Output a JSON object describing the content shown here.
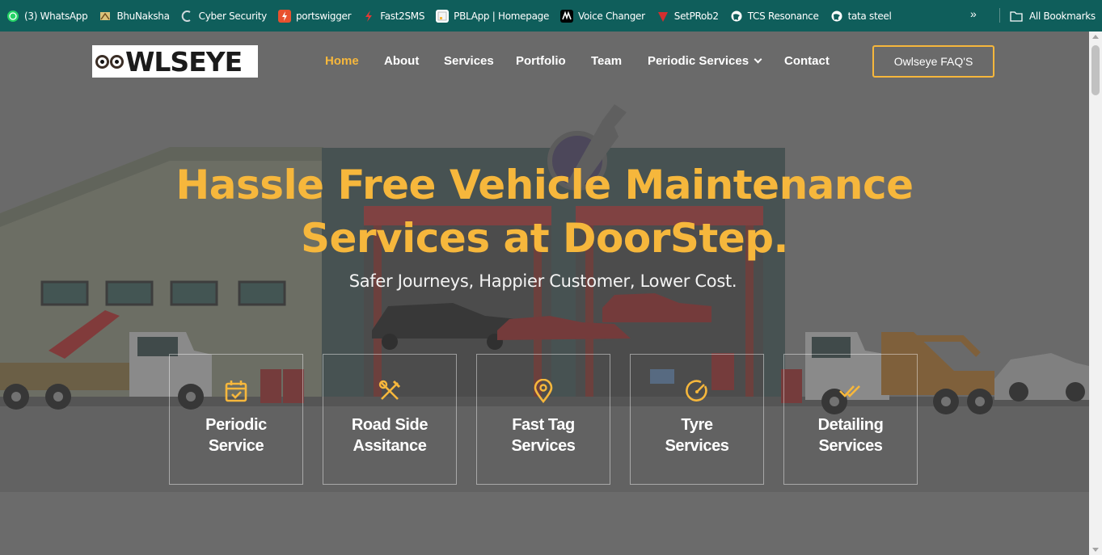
{
  "bookmarks_bar": {
    "items": [
      {
        "label": "(3) WhatsApp",
        "icon": "whatsapp-icon"
      },
      {
        "label": "BhuNaksha",
        "icon": "bhunaksha-icon"
      },
      {
        "label": "Cyber Security",
        "icon": "cyber-security-icon"
      },
      {
        "label": "portswigger",
        "icon": "portswigger-icon"
      },
      {
        "label": "Fast2SMS",
        "icon": "fast2sms-icon"
      },
      {
        "label": "PBLApp | Homepage",
        "icon": "pblapp-icon"
      },
      {
        "label": "Voice Changer",
        "icon": "voice-changer-icon"
      },
      {
        "label": "SetPRob2",
        "icon": "setprob-icon"
      },
      {
        "label": "TCS Resonance",
        "icon": "globe-icon"
      },
      {
        "label": "tata steel",
        "icon": "globe-icon"
      }
    ],
    "more": "»",
    "all_bookmarks": "All Bookmarks"
  },
  "header": {
    "logo_text": "WLSEYE",
    "nav": [
      {
        "label": "Home",
        "active": true
      },
      {
        "label": "About"
      },
      {
        "label": "Services"
      },
      {
        "label": "Portfolio"
      },
      {
        "label": "Team"
      },
      {
        "label": "Periodic Services",
        "has_dropdown": true
      },
      {
        "label": "Contact"
      }
    ],
    "faq_button": "Owlseye FAQ'S"
  },
  "hero": {
    "title_line1": "Hassle Free Vehicle Maintenance",
    "title_line2": "Services at DoorStep.",
    "subtitle": "Safer Journeys, Happier Customer, Lower Cost."
  },
  "services": [
    {
      "line1": "Periodic",
      "line2": "Service",
      "icon": "calendar-check-icon"
    },
    {
      "line1": "Road Side",
      "line2": "Assitance",
      "icon": "tools-icon"
    },
    {
      "line1": "Fast Tag",
      "line2": "Services",
      "icon": "location-pin-icon"
    },
    {
      "line1": "Tyre",
      "line2": "Services",
      "icon": "gauge-icon"
    },
    {
      "line1": "Detailing",
      "line2": "Services",
      "icon": "double-check-icon"
    }
  ],
  "colors": {
    "accent": "#f6b73c",
    "bookmarks_bar": "#0f5e5b",
    "overlay": "#6b6b6b"
  }
}
